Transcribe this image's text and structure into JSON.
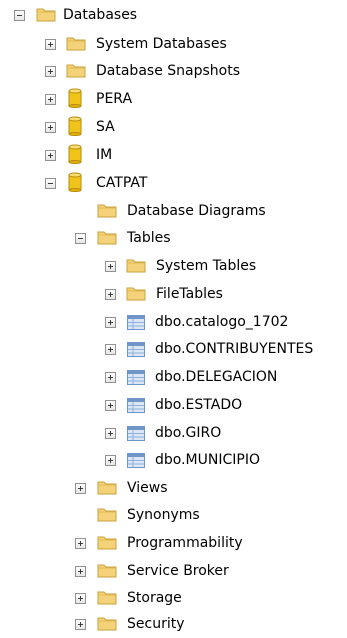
{
  "tree": {
    "databases": "Databases",
    "system_databases": "System Databases",
    "database_snapshots": "Database Snapshots",
    "db_pera": "PERA",
    "db_sa": "SA",
    "db_im": "IM",
    "db_catpat": "CATPAT",
    "catpat": {
      "database_diagrams": "Database Diagrams",
      "tables": "Tables",
      "tables_children": {
        "system_tables": "System Tables",
        "file_tables": "FileTables",
        "t1": "dbo.catalogo_1702",
        "t2": "dbo.CONTRIBUYENTES",
        "t3": "dbo.DELEGACION",
        "t4": "dbo.ESTADO",
        "t5": "dbo.GIRO",
        "t6": "dbo.MUNICIPIO"
      },
      "views": "Views",
      "synonyms": "Synonyms",
      "programmability": "Programmability",
      "service_broker": "Service Broker",
      "storage": "Storage",
      "security": "Security"
    }
  },
  "icons": {
    "folder_color": "#f4d27a",
    "database_color": "#f0c419",
    "table_color": "#6f95c9",
    "expander_border": "#919191"
  }
}
